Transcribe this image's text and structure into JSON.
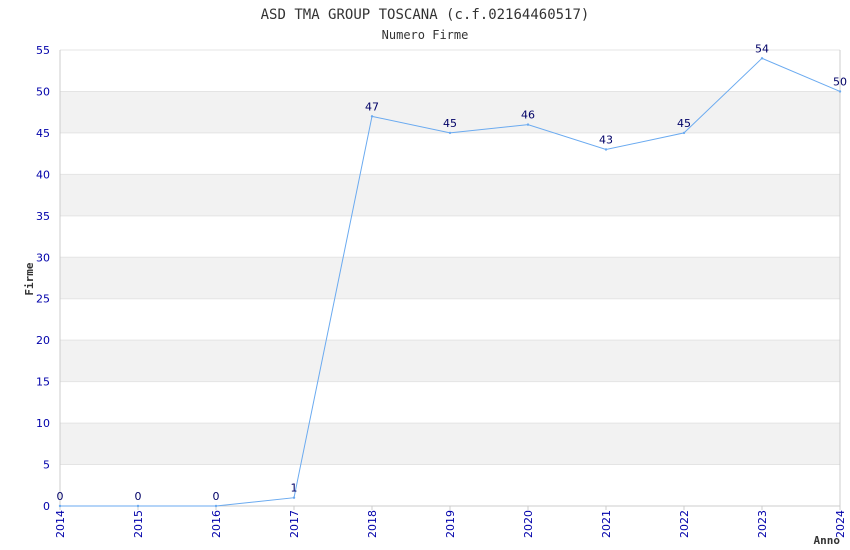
{
  "chart_data": {
    "type": "line",
    "title": "ASD TMA GROUP TOSCANA (c.f.02164460517)",
    "subtitle": "Numero Firme",
    "xlabel": "Anno",
    "ylabel": "Firme",
    "categories": [
      "2014",
      "2015",
      "2016",
      "2017",
      "2018",
      "2019",
      "2020",
      "2021",
      "2022",
      "2023",
      "2024"
    ],
    "values": [
      0,
      0,
      0,
      1,
      47,
      45,
      46,
      43,
      45,
      54,
      50
    ],
    "ylim": [
      0,
      55
    ],
    "yticks": [
      0,
      5,
      10,
      15,
      20,
      25,
      30,
      35,
      40,
      45,
      50,
      55
    ],
    "grid": true,
    "legend": "none",
    "colors": {
      "line": "#6aaaf0",
      "band": "#f2f2f2",
      "tick_text": "#0000aa",
      "value_text": "#000066",
      "title_text": "#333333",
      "axis": "#cccccc"
    }
  }
}
